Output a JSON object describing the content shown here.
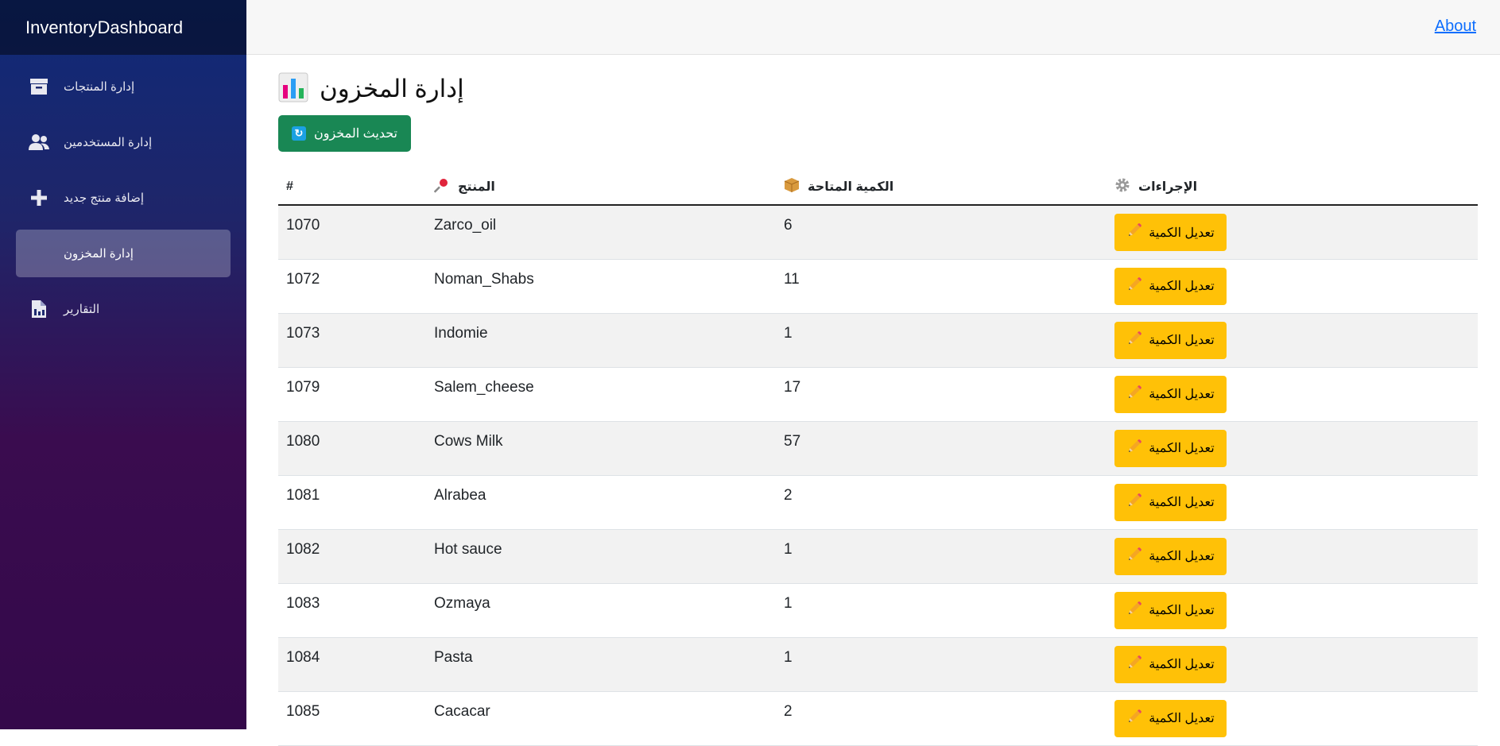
{
  "brand": "InventoryDashboard",
  "topbar": {
    "about_label": "About"
  },
  "sidebar": {
    "items": [
      {
        "label": "إدارة المنتجات",
        "icon": "archive-box-icon"
      },
      {
        "label": "إدارة المستخدمين",
        "icon": "users-icon"
      },
      {
        "label": "إضافة منتج جديد",
        "icon": "plus-icon"
      },
      {
        "label": "إدارة المخزون",
        "icon": "",
        "active": true
      },
      {
        "label": "التقارير",
        "icon": "report-document-icon"
      }
    ]
  },
  "page": {
    "title": "إدارة المخزون",
    "title_icon": "bar-chart-icon",
    "refresh_label": "تحديث المخزون",
    "refresh_icon": "refresh-icon"
  },
  "table": {
    "headers": {
      "id": "#",
      "product": "المنتج",
      "product_icon": "pushpin-icon",
      "quantity": "الكمية المتاحة",
      "quantity_icon": "package-icon",
      "actions": "الإجراءات",
      "actions_icon": "gear-icon"
    },
    "edit_label": "تعديل الكمية",
    "edit_icon": "pencil-icon",
    "rows": [
      {
        "id": "1070",
        "product": "Zarco_oil",
        "qty": "6"
      },
      {
        "id": "1072",
        "product": "Noman_Shabs",
        "qty": "11"
      },
      {
        "id": "1073",
        "product": "Indomie",
        "qty": "1"
      },
      {
        "id": "1079",
        "product": "Salem_cheese",
        "qty": "17"
      },
      {
        "id": "1080",
        "product": "Cows Milk",
        "qty": "57"
      },
      {
        "id": "1081",
        "product": "Alrabea",
        "qty": "2"
      },
      {
        "id": "1082",
        "product": "Hot sauce",
        "qty": "1"
      },
      {
        "id": "1083",
        "product": "Ozmaya",
        "qty": "1"
      },
      {
        "id": "1084",
        "product": "Pasta",
        "qty": "1"
      },
      {
        "id": "1085",
        "product": "Cacacar",
        "qty": "2"
      }
    ]
  },
  "colors": {
    "refresh_button": "#198754",
    "edit_button": "#ffc107",
    "link": "#0d6efd"
  }
}
